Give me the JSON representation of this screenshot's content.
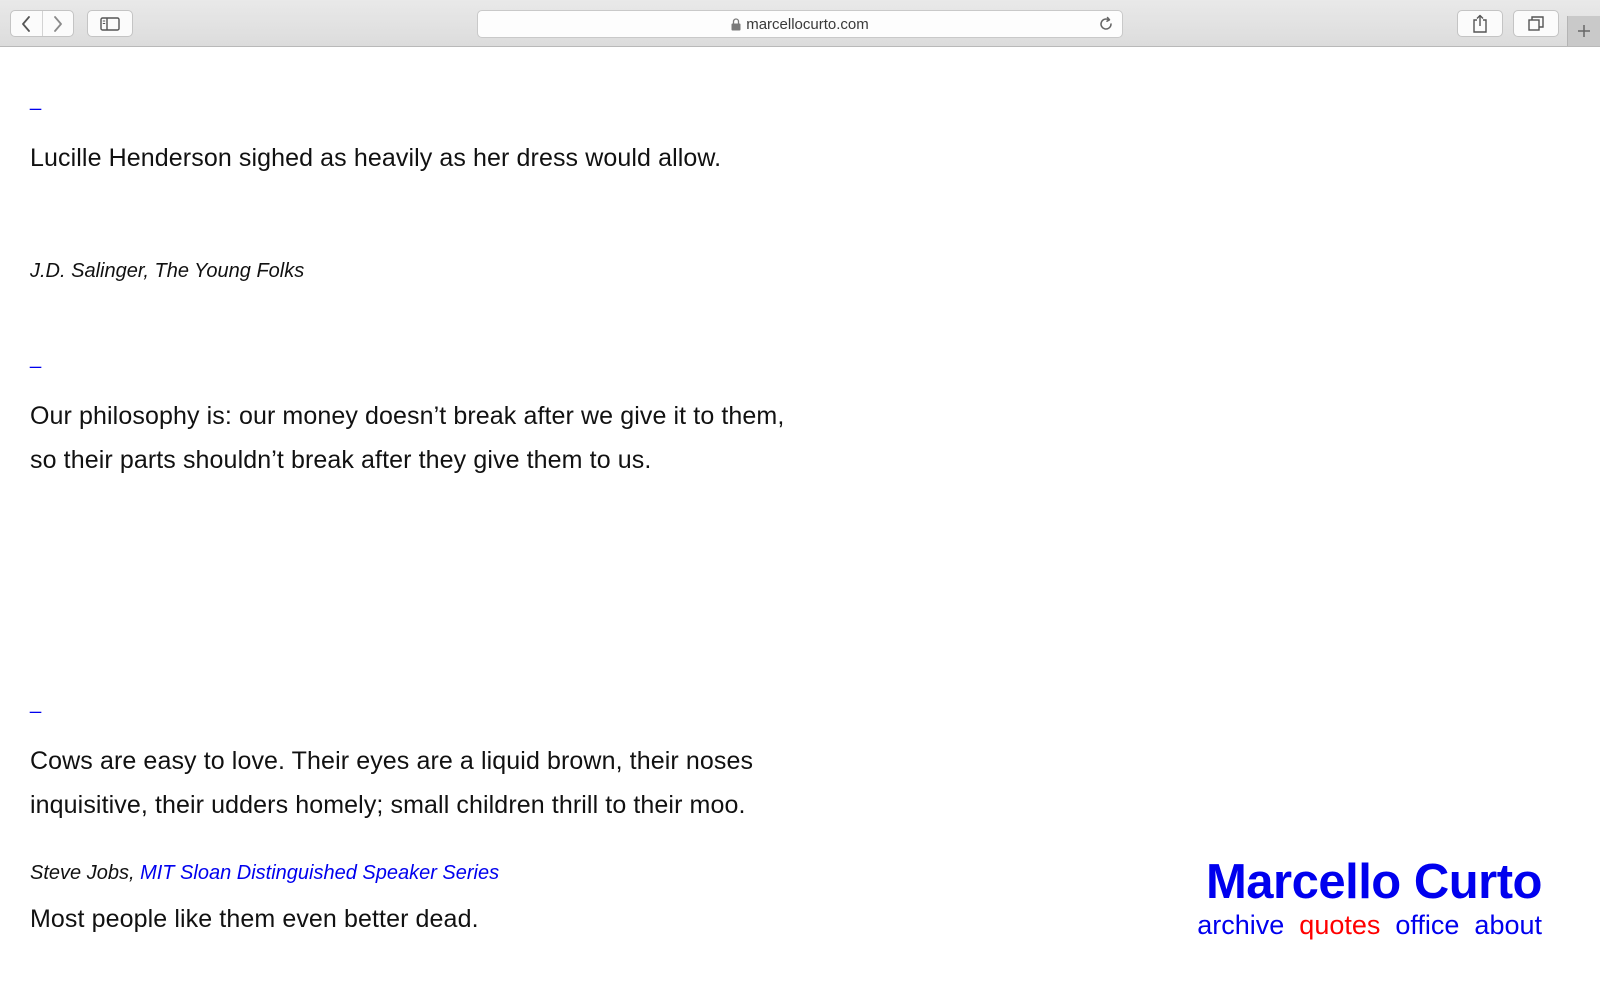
{
  "browser": {
    "url": "marcellocurto.com",
    "icons": {
      "back": "chevron-left-icon",
      "forward": "chevron-right-icon",
      "sidebar": "sidebar-icon",
      "lock": "lock-icon",
      "reload": "reload-icon",
      "share": "share-icon",
      "tabs": "tabs-icon",
      "new_tab": "plus-icon"
    }
  },
  "entries": [
    {
      "dash": "_",
      "quote": "Lucille Henderson sighed as heavily as her dress would allow.",
      "cite_prefix": "J.D. Salinger, The Young Folks"
    },
    {
      "dash": "_",
      "quote": "Our philosophy is: our money doesn’t break after we give it to them, so their parts shouldn’t break after they give them to us.",
      "cite_prefix": "Steve Jobs, ",
      "cite_link": "MIT Sloan Distinguished Speaker Series"
    },
    {
      "dash": "_",
      "quote_paragraphs": [
        "Cows are easy to love. Their eyes are a liquid brown, their noses inquisitive, their udders homely; small children thrill to their moo.",
        "Most people like them even better dead."
      ]
    }
  ],
  "site": {
    "name": "Marcello Curto",
    "nav": [
      {
        "label": "archive",
        "active": false
      },
      {
        "label": "quotes",
        "active": true
      },
      {
        "label": "office",
        "active": false
      },
      {
        "label": "about",
        "active": false
      }
    ]
  },
  "colors": {
    "link": "#0000ee",
    "active": "#ff0000",
    "text": "#111111"
  }
}
